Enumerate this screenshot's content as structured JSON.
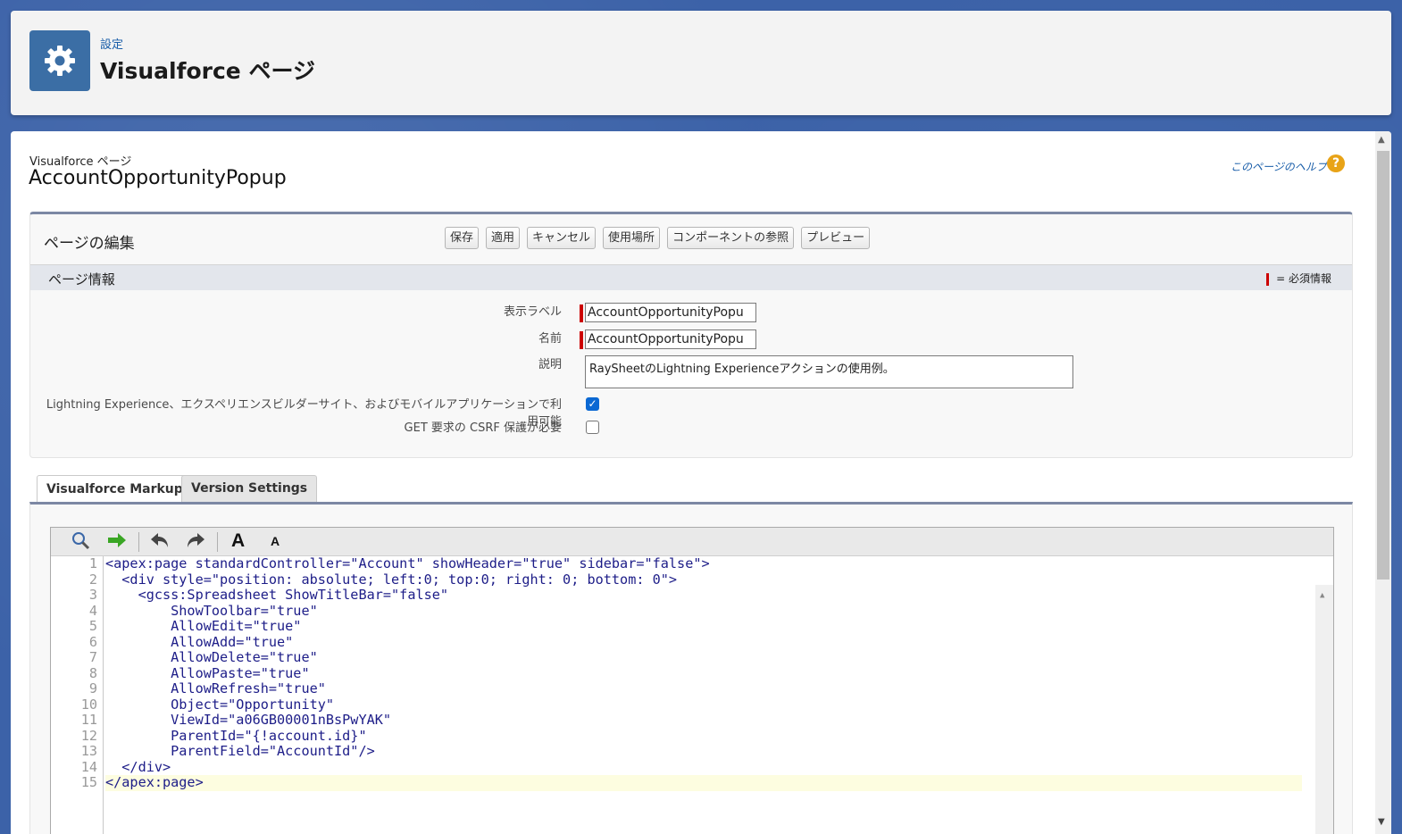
{
  "header": {
    "breadcrumb": "設定",
    "title": "Visualforce ページ",
    "icon": "gear-icon"
  },
  "page": {
    "type_label": "Visualforce ページ",
    "name": "AccountOpportunityPopup",
    "help_link": "このページのヘルプ",
    "help_icon": "?"
  },
  "edit": {
    "title": "ページの編集",
    "buttons": [
      "保存",
      "適用",
      "キャンセル",
      "使用場所",
      "コンポーネントの参照",
      "プレビュー"
    ]
  },
  "info": {
    "section_title": "ページ情報",
    "required_legend": "= 必須情報",
    "label_field_label": "表示ラベル",
    "label_field_value": "AccountOpportunityPopu",
    "name_field_label": "名前",
    "name_field_value": "AccountOpportunityPopu",
    "description_label": "説明",
    "description_value": "RaySheetのLightning Experienceアクションの使用例。",
    "lightning_label": "Lightning Experience、エクスペリエンスビルダーサイト、およびモバイルアプリケーションで利用可能",
    "lightning_checked": true,
    "csrf_label": "GET 要求の CSRF 保護が必要",
    "csrf_checked": false
  },
  "tabs": {
    "markup": "Visualforce Markup",
    "version": "Version Settings"
  },
  "toolbar": {
    "icons": [
      "search-icon",
      "goto-line-icon",
      "undo-icon",
      "redo-icon",
      "font-increase-icon",
      "font-decrease-icon"
    ]
  },
  "code": {
    "line_numbers": [
      "1",
      "2",
      "3",
      "4",
      "5",
      "6",
      "7",
      "8",
      "9",
      "10",
      "11",
      "12",
      "13",
      "14",
      "15"
    ],
    "lines": [
      "<apex:page standardController=\"Account\" showHeader=\"true\" sidebar=\"false\">",
      "  <div style=\"position: absolute; left:0; top:0; right: 0; bottom: 0\">",
      "    <gcss:Spreadsheet ShowTitleBar=\"false\"",
      "        ShowToolbar=\"true\"",
      "        AllowEdit=\"true\"",
      "        AllowAdd=\"true\"",
      "        AllowDelete=\"true\"",
      "        AllowPaste=\"true\"",
      "        AllowRefresh=\"true\"",
      "        Object=\"Opportunity\"",
      "        ViewId=\"a06GB00001nBsPwYAK\"",
      "        ParentId=\"{!account.id}\"",
      "        ParentField=\"AccountId\"/>",
      "  </div>",
      "</apex:page>"
    ]
  },
  "colors": {
    "accent": "#3b6ea5",
    "link": "#1a5ea9",
    "required": "#cc0000",
    "checkbox": "#0b68d3"
  }
}
